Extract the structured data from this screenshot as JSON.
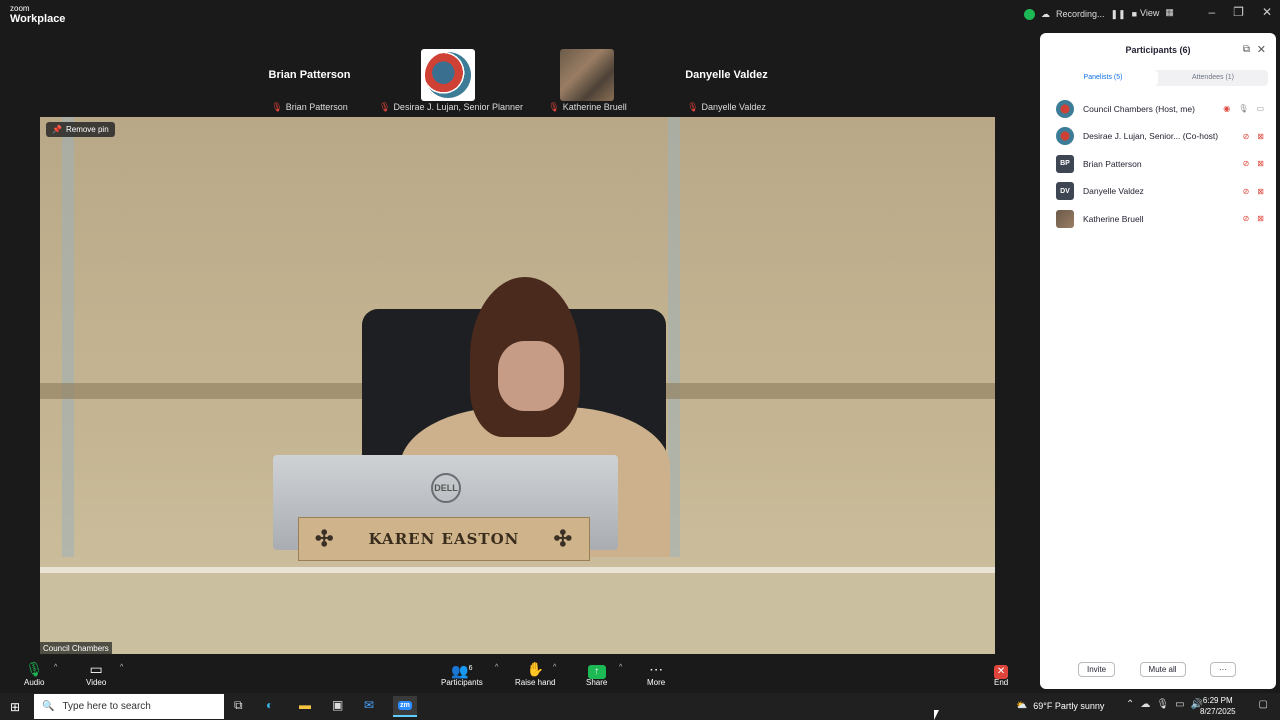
{
  "app": {
    "brand_top": "zoom",
    "brand_bottom": "Workplace",
    "recording": "Recording...",
    "view": "View"
  },
  "window_controls": [
    "–",
    "❐",
    "✕"
  ],
  "gallery": [
    {
      "name": "Brian Patterson",
      "label": "Brian Patterson",
      "type": "text"
    },
    {
      "name": "",
      "label": "Desirae J. Lujan, Senior Planner",
      "type": "logo"
    },
    {
      "name": "",
      "label": "Katherine Bruell",
      "type": "photo"
    },
    {
      "name": "Danyelle Valdez",
      "label": "Danyelle Valdez",
      "type": "text"
    }
  ],
  "main_video": {
    "remove_pin": "Remove pin",
    "label": "Council Chambers",
    "nameplate": "KAREN EASTON",
    "monitor_brand": "DELL"
  },
  "participants_panel": {
    "title": "Participants (6)",
    "tabs": [
      {
        "label": "Panelists (5)",
        "active": true
      },
      {
        "label": "Attendees (1)",
        "active": false
      }
    ],
    "rows": [
      {
        "name": "Council Chambers (Host, me)",
        "avatar": "logo",
        "initials": ""
      },
      {
        "name": "Desirae J. Lujan, Senior... (Co-host)",
        "avatar": "logo",
        "initials": ""
      },
      {
        "name": "Brian Patterson",
        "avatar": "initials",
        "initials": "BP"
      },
      {
        "name": "Danyelle Valdez",
        "avatar": "initials",
        "initials": "DV"
      },
      {
        "name": "Katherine Bruell",
        "avatar": "photo",
        "initials": ""
      }
    ],
    "invite": "Invite",
    "mute_all": "Mute all",
    "more": "···"
  },
  "toolbar": {
    "audio": "Audio",
    "video": "Video",
    "participants": "Participants",
    "participants_count": "6",
    "raise_hand": "Raise hand",
    "share": "Share",
    "more": "More",
    "end": "End"
  },
  "taskbar": {
    "search_placeholder": "Type here to search",
    "weather": "69°F  Partly sunny",
    "time": "6:29 PM",
    "date": "8/27/2025",
    "zoom_icon": "zm"
  },
  "colors": {
    "accent": "#0e71eb",
    "muted_red": "#e0453b",
    "share_green": "#1db954"
  }
}
